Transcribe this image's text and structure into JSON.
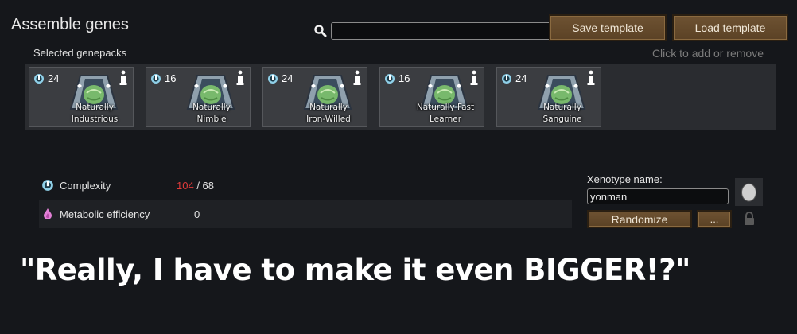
{
  "title": "Assemble genes",
  "search": {
    "placeholder": "",
    "value": ""
  },
  "buttons": {
    "save_template": "Save template",
    "load_template": "Load template",
    "randomize": "Randomize",
    "more": "..."
  },
  "selected_label": "Selected genepacks",
  "hint": "Click to add or remove",
  "genepacks": [
    {
      "complexity": "24",
      "line1": "Naturally",
      "line2": "Industrious"
    },
    {
      "complexity": "16",
      "line1": "Naturally",
      "line2": "Nimble"
    },
    {
      "complexity": "24",
      "line1": "Naturally",
      "line2": "Iron-Willed"
    },
    {
      "complexity": "16",
      "line1": "Naturally Fast",
      "line2": "Learner"
    },
    {
      "complexity": "24",
      "line1": "Naturally",
      "line2": "Sanguine"
    }
  ],
  "stats": {
    "complexity": {
      "label": "Complexity",
      "current": "104",
      "separator": " / ",
      "max": "68"
    },
    "metabolic": {
      "label": "Metabolic efficiency",
      "value": "0"
    }
  },
  "xenotype": {
    "label": "Xenotype name:",
    "value": "yonman"
  },
  "caption": "\"Really, I have to make it even BIGGER!?\"",
  "colors": {
    "accent_button": "#6e5232",
    "over_limit": "#e03a3a",
    "complexity_icon": "#8fd0e8",
    "metabolic_icon": "#e27fd6"
  },
  "icons": [
    "search-icon",
    "complexity-icon",
    "info-icon",
    "genepack-icon",
    "metabolic-icon",
    "xenotype-icon",
    "lock-icon"
  ]
}
